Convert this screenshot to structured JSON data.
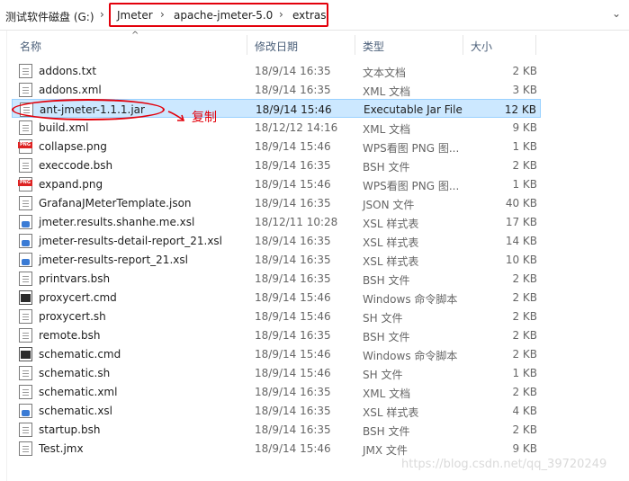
{
  "address_bar": {
    "drive": "测试软件磁盘 (G:)",
    "crumbs": [
      "Jmeter",
      "apache-jmeter-5.0",
      "extras"
    ],
    "separator": "›",
    "dropdown_icon": "chevron-down-icon"
  },
  "columns": {
    "name": "名称",
    "modified": "修改日期",
    "type": "类型",
    "size": "大小",
    "sort_indicator": "^"
  },
  "files": [
    {
      "name": "addons.txt",
      "modified": "18/9/14 16:35",
      "type": "文本文档",
      "size": "2 KB",
      "icon": "document-icon"
    },
    {
      "name": "addons.xml",
      "modified": "18/9/14 16:35",
      "type": "XML 文档",
      "size": "3 KB",
      "icon": "document-icon"
    },
    {
      "name": "ant-jmeter-1.1.1.jar",
      "modified": "18/9/14 15:46",
      "type": "Executable Jar File",
      "size": "12 KB",
      "icon": "document-icon",
      "selected": true
    },
    {
      "name": "build.xml",
      "modified": "18/12/12 14:16",
      "type": "XML 文档",
      "size": "9 KB",
      "icon": "document-icon"
    },
    {
      "name": "collapse.png",
      "modified": "18/9/14 15:46",
      "type": "WPS看图 PNG 图...",
      "size": "1 KB",
      "icon": "png-image-icon"
    },
    {
      "name": "execcode.bsh",
      "modified": "18/9/14 16:35",
      "type": "BSH 文件",
      "size": "2 KB",
      "icon": "document-icon"
    },
    {
      "name": "expand.png",
      "modified": "18/9/14 15:46",
      "type": "WPS看图 PNG 图...",
      "size": "1 KB",
      "icon": "png-image-icon"
    },
    {
      "name": "GrafanaJMeterTemplate.json",
      "modified": "18/9/14 16:35",
      "type": "JSON 文件",
      "size": "40 KB",
      "icon": "document-icon"
    },
    {
      "name": "jmeter.results.shanhe.me.xsl",
      "modified": "18/12/11 10:28",
      "type": "XSL 样式表",
      "size": "17 KB",
      "icon": "xsl-stylesheet-icon"
    },
    {
      "name": "jmeter-results-detail-report_21.xsl",
      "modified": "18/9/14 16:35",
      "type": "XSL 样式表",
      "size": "14 KB",
      "icon": "xsl-stylesheet-icon"
    },
    {
      "name": "jmeter-results-report_21.xsl",
      "modified": "18/9/14 16:35",
      "type": "XSL 样式表",
      "size": "10 KB",
      "icon": "xsl-stylesheet-icon"
    },
    {
      "name": "printvars.bsh",
      "modified": "18/9/14 16:35",
      "type": "BSH 文件",
      "size": "2 KB",
      "icon": "document-icon"
    },
    {
      "name": "proxycert.cmd",
      "modified": "18/9/14 15:46",
      "type": "Windows 命令脚本",
      "size": "2 KB",
      "icon": "command-script-icon"
    },
    {
      "name": "proxycert.sh",
      "modified": "18/9/14 15:46",
      "type": "SH 文件",
      "size": "2 KB",
      "icon": "document-icon"
    },
    {
      "name": "remote.bsh",
      "modified": "18/9/14 16:35",
      "type": "BSH 文件",
      "size": "2 KB",
      "icon": "document-icon"
    },
    {
      "name": "schematic.cmd",
      "modified": "18/9/14 15:46",
      "type": "Windows 命令脚本",
      "size": "2 KB",
      "icon": "command-script-icon"
    },
    {
      "name": "schematic.sh",
      "modified": "18/9/14 15:46",
      "type": "SH 文件",
      "size": "1 KB",
      "icon": "document-icon"
    },
    {
      "name": "schematic.xml",
      "modified": "18/9/14 16:35",
      "type": "XML 文档",
      "size": "2 KB",
      "icon": "document-icon"
    },
    {
      "name": "schematic.xsl",
      "modified": "18/9/14 16:35",
      "type": "XSL 样式表",
      "size": "4 KB",
      "icon": "xsl-stylesheet-icon"
    },
    {
      "name": "startup.bsh",
      "modified": "18/9/14 16:35",
      "type": "BSH 文件",
      "size": "2 KB",
      "icon": "document-icon"
    },
    {
      "name": "Test.jmx",
      "modified": "18/9/14 15:46",
      "type": "JMX 文件",
      "size": "9 KB",
      "icon": "document-icon"
    }
  ],
  "annotation": {
    "text": "复制",
    "color": "#e3000b"
  },
  "watermark": "https://blog.csdn.net/qq_39720249",
  "colors": {
    "selection_bg": "#cce8ff",
    "selection_border": "#99d1ff",
    "header_text": "#4c607a"
  }
}
